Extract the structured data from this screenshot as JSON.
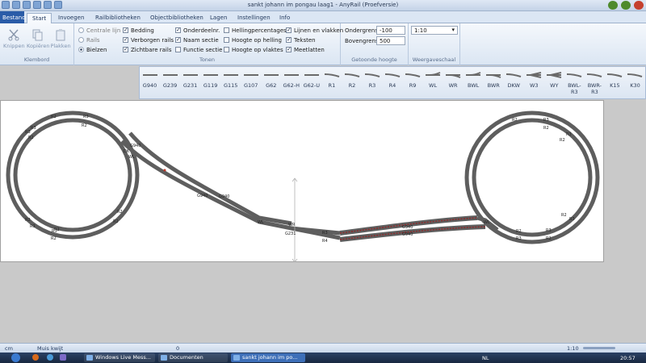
{
  "window": {
    "title": "sankt johann im pongau laag1 - AnyRail (Proefversie)"
  },
  "tabs": [
    "Bestand",
    "Start",
    "Invoegen",
    "Railbibliotheken",
    "Objectbibliotheken",
    "Lagen",
    "Instellingen",
    "Info"
  ],
  "clipboard": {
    "cut": "Knippen",
    "copy": "Kopiëren",
    "paste": "Plakken",
    "group": "Klembord"
  },
  "tonen": {
    "group": "Tonen",
    "radios": [
      {
        "label": "Centrale lijn",
        "checked": false
      },
      {
        "label": "Rails",
        "checked": false
      },
      {
        "label": "Bielzen",
        "checked": true
      }
    ],
    "col2": [
      {
        "label": "Bedding",
        "checked": true
      },
      {
        "label": "Verborgen rails",
        "checked": true
      },
      {
        "label": "Zichtbare rails",
        "checked": true
      }
    ],
    "col3": [
      {
        "label": "Onderdeelnr.",
        "checked": true
      },
      {
        "label": "Naam sectie",
        "checked": true
      },
      {
        "label": "Functie sectie",
        "checked": false
      }
    ],
    "col4": [
      {
        "label": "Hellingpercentages",
        "checked": false
      },
      {
        "label": "Hoogte op helling",
        "checked": false
      },
      {
        "label": "Hoogte op vlaktes",
        "checked": false
      }
    ],
    "col5": [
      {
        "label": "Lijnen en vlakken",
        "checked": true
      },
      {
        "label": "Teksten",
        "checked": true
      },
      {
        "label": "Meetlatten",
        "checked": true
      }
    ]
  },
  "height": {
    "group": "Getoonde hoogte",
    "lower_label": "Ondergrens",
    "lower_value": "-100",
    "upper_label": "Bovengrens",
    "upper_value": "500"
  },
  "scale": {
    "group": "Weergaveschaal",
    "value": "1:10"
  },
  "palette": [
    "G940",
    "G239",
    "G231",
    "G119",
    "G115",
    "G107",
    "G62",
    "G62-H",
    "G62-U",
    "R1",
    "R2",
    "R3",
    "R4",
    "R9",
    "WL",
    "WR",
    "BWL",
    "BWR",
    "DKW",
    "W3",
    "WY",
    "BWL-R3",
    "BWR-R3",
    "K15",
    "K30"
  ],
  "track_labels": {
    "left": [
      "R2",
      "R3",
      "R3",
      "R2",
      "R3",
      "R2",
      "R2",
      "R2",
      "R2",
      "R2",
      "R3",
      "R3",
      "R2",
      "DK",
      "G940",
      "WL"
    ],
    "middle": [
      "G940",
      "G940",
      "WL",
      "WR",
      "G231",
      "R3",
      "R4",
      "G940",
      "G940"
    ],
    "right": [
      "R2",
      "R3",
      "R2",
      "R3",
      "R2",
      "R3",
      "R2",
      "R3",
      "R2",
      "R3",
      "WL",
      "R2"
    ]
  },
  "status": {
    "unit": "cm",
    "mouse": "Muis kwijt",
    "count": "0",
    "zoom": "1:10"
  },
  "taskbar": {
    "items": [
      "Windows Live Mess...",
      "Documenten",
      "sankt johann im po..."
    ],
    "lang": "NL",
    "clock": "20:57"
  },
  "colors": {
    "track": "#5e5e5e",
    "highlight": "#8b2a2a",
    "ribbon": "#dbe6f4",
    "file_tab": "#2a5ca8"
  }
}
